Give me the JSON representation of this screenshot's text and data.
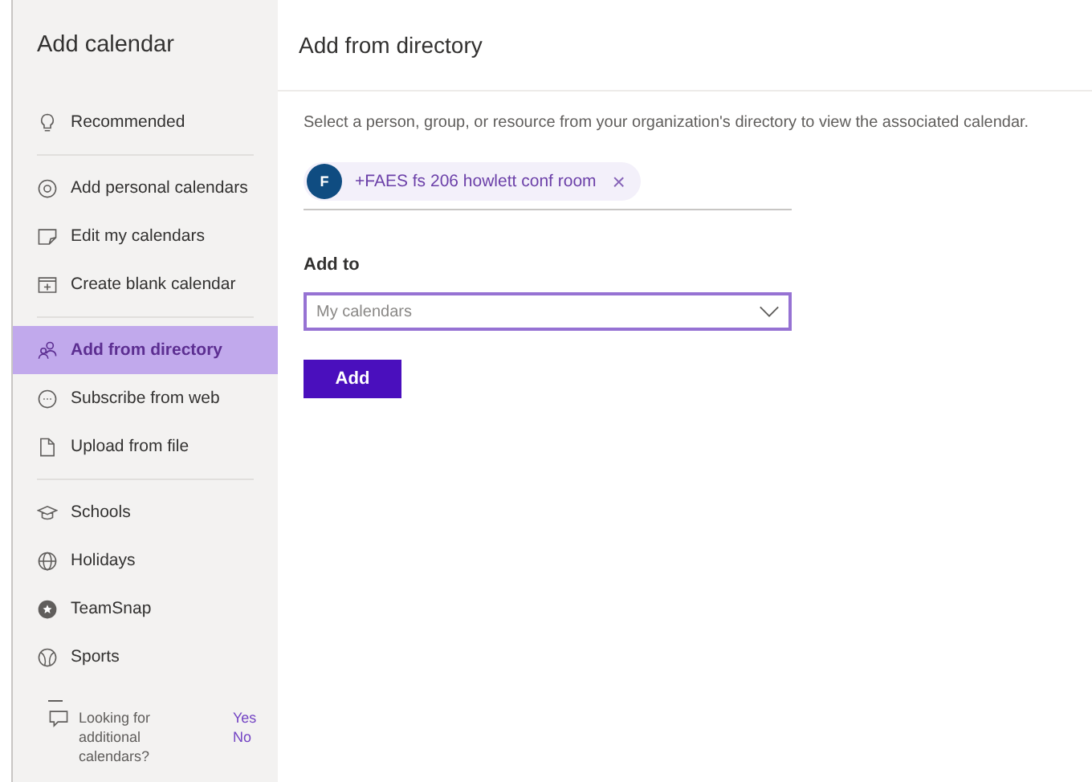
{
  "sidebar": {
    "title": "Add calendar",
    "groups": [
      [
        {
          "label": "Recommended",
          "selected": false
        }
      ],
      [
        {
          "label": "Add personal calendars",
          "selected": false
        },
        {
          "label": "Edit my calendars",
          "selected": false
        },
        {
          "label": "Create blank calendar",
          "selected": false
        }
      ],
      [
        {
          "label": "Add from directory",
          "selected": true
        },
        {
          "label": "Subscribe from web",
          "selected": false
        },
        {
          "label": "Upload from file",
          "selected": false
        }
      ],
      [
        {
          "label": "Schools",
          "selected": false
        },
        {
          "label": "Holidays",
          "selected": false
        },
        {
          "label": "TeamSnap",
          "selected": false
        },
        {
          "label": "Sports",
          "selected": false
        }
      ]
    ],
    "feedback": {
      "question": "Looking for additional calendars?",
      "yes": "Yes",
      "no": "No"
    }
  },
  "main": {
    "title": "Add from directory",
    "description": "Select a person, group, or resource from your organization's directory to view the associated calendar.",
    "chip": {
      "initial": "F",
      "label": "+FAES fs 206 howlett conf room",
      "remove": "×"
    },
    "add_to_label": "Add to",
    "dropdown": {
      "placeholder": "My calendars"
    },
    "add_button": "Add"
  }
}
